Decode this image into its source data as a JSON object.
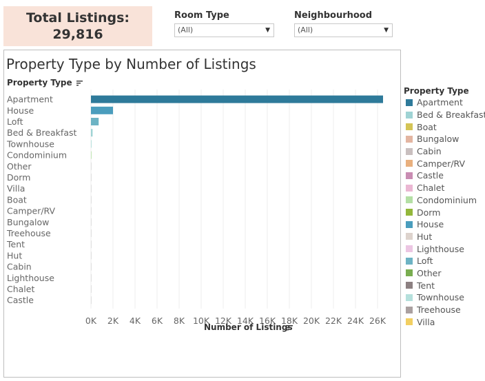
{
  "kpi": {
    "title": "Total Listings:",
    "value": "29,816"
  },
  "filters": [
    {
      "label": "Room Type",
      "value": "(All)"
    },
    {
      "label": "Neighbourhood",
      "value": "(All)"
    }
  ],
  "chart_data": {
    "type": "bar",
    "orientation": "horizontal",
    "title": "Property Type by Number of Listings",
    "category_header": "Property Type",
    "xlabel": "Number of Listings",
    "xlim": [
      0,
      27000
    ],
    "grid": true,
    "legend_placement": "right",
    "categories": [
      "Apartment",
      "House",
      "Loft",
      "Bed & Breakfast",
      "Townhouse",
      "Condominium",
      "Other",
      "Dorm",
      "Villa",
      "Boat",
      "Camper/RV",
      "Bungalow",
      "Treehouse",
      "Tent",
      "Hut",
      "Cabin",
      "Lighthouse",
      "Chalet",
      "Castle"
    ],
    "values": [
      26500,
      2000,
      700,
      150,
      60,
      50,
      20,
      10,
      8,
      6,
      5,
      4,
      3,
      3,
      2,
      2,
      1,
      1,
      1
    ],
    "x_ticks": [
      "0K",
      "2K",
      "4K",
      "6K",
      "8K",
      "10K",
      "12K",
      "14K",
      "16K",
      "18K",
      "20K",
      "22K",
      "24K",
      "26K"
    ],
    "x_tick_values": [
      0,
      2000,
      4000,
      6000,
      8000,
      10000,
      12000,
      14000,
      16000,
      18000,
      20000,
      22000,
      24000,
      26000
    ],
    "bar_colors": {
      "Apartment": "#2e7a9a",
      "House": "#4a9dbd",
      "Loft": "#6db3c4",
      "Bed & Breakfast": "#9fd3d4",
      "Townhouse": "#b5e0dc",
      "Condominium": "#b4dfa5"
    }
  },
  "legend": {
    "title": "Property Type",
    "items": [
      {
        "label": "Apartment",
        "color": "#2e7a9a"
      },
      {
        "label": "Bed & Breakfast",
        "color": "#9fd3d4"
      },
      {
        "label": "Boat",
        "color": "#d4c456"
      },
      {
        "label": "Bungalow",
        "color": "#e3b5a1"
      },
      {
        "label": "Cabin",
        "color": "#c9bfbf"
      },
      {
        "label": "Camper/RV",
        "color": "#e9b07e"
      },
      {
        "label": "Castle",
        "color": "#c98db3"
      },
      {
        "label": "Chalet",
        "color": "#ebb7d3"
      },
      {
        "label": "Condominium",
        "color": "#b4dfa5"
      },
      {
        "label": "Dorm",
        "color": "#93b73b"
      },
      {
        "label": "House",
        "color": "#4a9dbd"
      },
      {
        "label": "Hut",
        "color": "#ddd3cd"
      },
      {
        "label": "Lighthouse",
        "color": "#ecc6e3"
      },
      {
        "label": "Loft",
        "color": "#6db3c4"
      },
      {
        "label": "Other",
        "color": "#79ad50"
      },
      {
        "label": "Tent",
        "color": "#8c8081"
      },
      {
        "label": "Townhouse",
        "color": "#b5e0dc"
      },
      {
        "label": "Treehouse",
        "color": "#aaa0a0"
      },
      {
        "label": "Villa",
        "color": "#f2cf62"
      }
    ]
  }
}
